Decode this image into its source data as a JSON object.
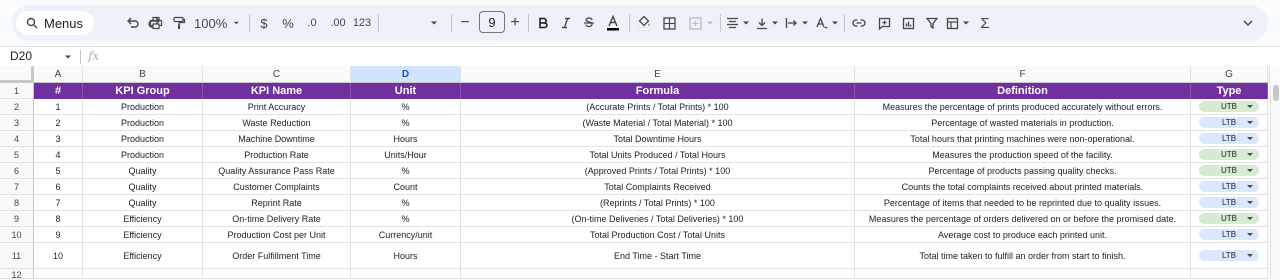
{
  "toolbar": {
    "menus_label": "Menus",
    "zoom": "100%",
    "currency": "$",
    "percent": "%",
    "dec_decrease": ".0",
    "dec_increase": ".00",
    "number_format": "123",
    "font_size": "9",
    "minus": "−",
    "plus": "+",
    "sigma": "Σ"
  },
  "formula_bar": {
    "cell_ref": "D20",
    "fx": "fx"
  },
  "columns": [
    "A",
    "B",
    "C",
    "D",
    "E",
    "F",
    "G"
  ],
  "selected_column": "D",
  "header_row": [
    "#",
    "KPI Group",
    "KPI Name",
    "Unit",
    "Formula",
    "Definition",
    "Type"
  ],
  "rows": [
    {
      "n": "2",
      "cells": [
        "1",
        "Production",
        "Print Accuracy",
        "%",
        "(Accurate Prints / Total Prints) * 100",
        "Measures the percentage of prints produced accurately without errors.",
        "UTB"
      ]
    },
    {
      "n": "3",
      "cells": [
        "2",
        "Production",
        "Waste Reduction",
        "%",
        "(Waste Material / Total Material) * 100",
        "Percentage of wasted materials in production.",
        "LTB"
      ]
    },
    {
      "n": "4",
      "cells": [
        "3",
        "Production",
        "Machine Downtime",
        "Hours",
        "Total Downtime Hours",
        "Total hours that printing machines were non-operational.",
        "LTB"
      ]
    },
    {
      "n": "5",
      "cells": [
        "4",
        "Production",
        "Production Rate",
        "Units/Hour",
        "Total Units Produced / Total Hours",
        "Measures the production speed of the facility.",
        "UTB"
      ]
    },
    {
      "n": "6",
      "cells": [
        "5",
        "Quality",
        "Quality Assurance Pass Rate",
        "%",
        "(Approved Prints / Total Prints) * 100",
        "Percentage of products passing quality checks.",
        "UTB"
      ]
    },
    {
      "n": "7",
      "cells": [
        "6",
        "Quality",
        "Customer Complaints",
        "Count",
        "Total Complaints Received",
        "Counts the total complaints received about printed materials.",
        "LTB"
      ]
    },
    {
      "n": "8",
      "cells": [
        "7",
        "Quality",
        "Reprint Rate",
        "%",
        "(Reprints / Total Prints) * 100",
        "Percentage of items that needed to be reprinted due to quality issues.",
        "LTB"
      ]
    },
    {
      "n": "9",
      "cells": [
        "8",
        "Efficiency",
        "On-time Delivery Rate",
        "%",
        "(On-time Deliveries / Total Deliveries) * 100",
        "Measures the percentage of orders delivered on or before the promised date.",
        "UTB"
      ]
    },
    {
      "n": "10",
      "cells": [
        "9",
        "Efficiency",
        "Production Cost per Unit",
        "Currency/unit",
        "Total Production Cost / Total Units",
        "Average cost to produce each printed unit.",
        "LTB"
      ]
    },
    {
      "n": "11",
      "cells": [
        "10",
        "Efficiency",
        "Order Fulfillment Time",
        "Hours",
        "End Time - Start Time",
        "Total time taken to fulfill an order from start to finish.",
        "LTB"
      ]
    }
  ],
  "header_row_number": "1",
  "next_row_number": "12",
  "colors": {
    "header_bg": "#7030a0",
    "utb_chip": "#d9ead3",
    "ltb_chip": "#dbe8fb"
  }
}
